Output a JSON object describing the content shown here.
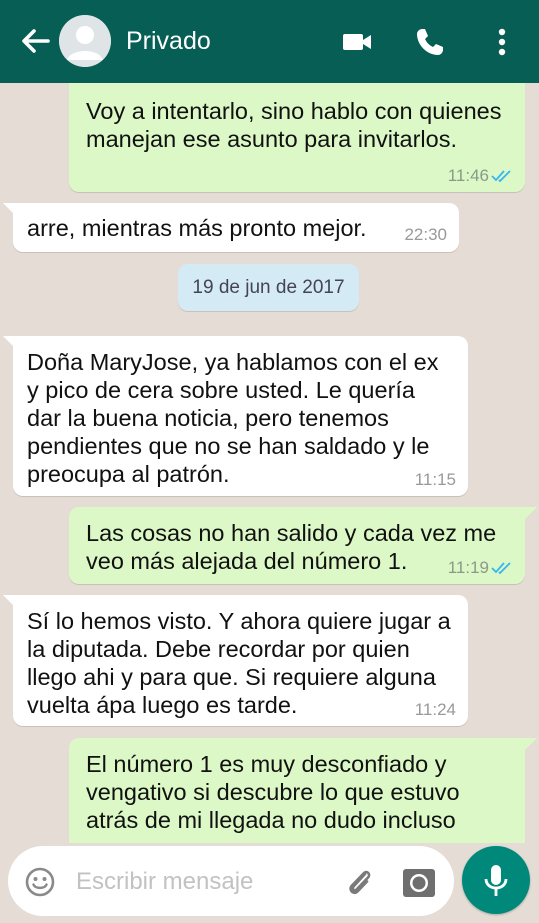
{
  "header": {
    "title": "Privado"
  },
  "messages": [
    {
      "text": "Voy a intentarlo, sino hablo con quienes\nmanejan ese asunto para invitarlos.",
      "time": "11:46"
    },
    {
      "text": "arre, mientras más pronto mejor.",
      "time": "22:30"
    },
    {
      "text": "Doña MaryJose, ya hablamos con el ex\ny pico de cera sobre usted. Le quería\ndar la buena noticia, pero tenemos\npendientes que no se han saldado y le\npreocupa al patrón.",
      "time": "11:15"
    },
    {
      "text": "Las cosas no han salido y cada vez me\nveo más alejada del número 1.",
      "time": "11:19"
    },
    {
      "text": "Sí lo hemos visto. Y ahora quiere jugar a\nla diputada. Debe recordar por quien\nllego ahi y para que. Si requiere alguna\nvuelta ápa luego es tarde.",
      "time": "11:24"
    },
    {
      "text": " El número 1 es muy desconfiado y\nvengativo si descubre lo que estuvo\natrás de mi llegada no dudo incluso",
      "time": ""
    }
  ],
  "date_divider": "19 de jun de 2017",
  "composer": {
    "placeholder": "Escribir mensaje"
  },
  "colors": {
    "header": "#075e54",
    "outgoing_bubble": "#dcf8c6",
    "incoming_bubble": "#ffffff",
    "date_chip": "#d4eaf4",
    "read_ticks": "#34b7f1",
    "mic_button": "#00897b"
  },
  "icons": [
    "back-arrow-icon",
    "avatar-icon",
    "video-call-icon",
    "phone-icon",
    "more-options-icon",
    "emoji-icon",
    "attach-icon",
    "camera-icon",
    "mic-icon",
    "double-check-icon"
  ]
}
